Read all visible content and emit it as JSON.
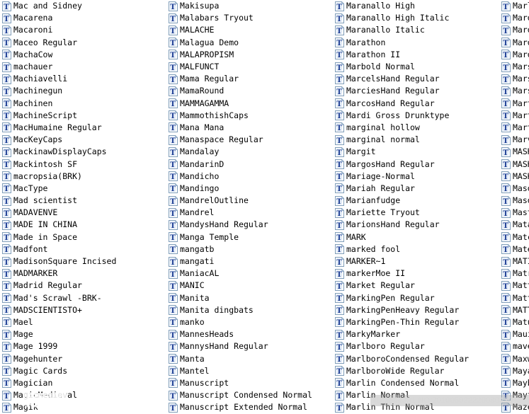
{
  "window": {
    "view": "list",
    "icon_name": "truetype-font-file-icon",
    "columns": 4,
    "rows_per_column": 34
  },
  "watermark": {
    "logo_cn": "昵图网",
    "logo_url": "www.nipic.cn",
    "id_text": "ID:3844391 NO:20100502222008043033"
  },
  "colors": {
    "background": "#ffffff",
    "text": "#000000",
    "icon_fill": "#ffffff",
    "icon_border": "#7f9db9",
    "icon_glyph": "#1f3f94",
    "icon_shade": "#c8d8ee"
  },
  "files": [
    "Mac and Sidney",
    "Macarena",
    "Macaroni",
    "Maceo Regular",
    "MachaCow",
    "machauer",
    "Machiavelli",
    "Machinegun",
    "Machinen",
    "MachineScript",
    "MacHumaine Regular",
    "MacKeyCaps",
    "MackinawDisplayCaps",
    "Mackintosh SF",
    "macropsia(BRK)",
    "MacType",
    "Mad scientist",
    "MADAVENVE",
    "MADE IN CHINA",
    "Made in Space",
    "Madfont",
    "MadisonSquare Incised",
    "MADMARKER",
    "Madrid Regular",
    "Mad's Scrawl -BRK-",
    "MADSCIENTISTO+",
    "Mael",
    "Mage",
    "Mage 1999",
    "Magehunter",
    "Magic Cards",
    "Magician",
    "MagicMedieval",
    "Magik",
    "Makisupa",
    "Malabars Tryout",
    "MALACHE",
    "Malagua Demo",
    "MALAPROPISM",
    "MALFUNCT",
    "Mama Regular",
    "MamaRound",
    "MAMMAGAMMA",
    "MammothishCaps",
    "Mana Mana",
    "Manaspace Regular",
    "Mandalay",
    "MandarinD",
    "Mandicho",
    "Mandingo",
    "MandrelOutline",
    "Mandrel",
    "MandysHand Regular",
    "Manga Temple",
    "mangatb",
    "mangati",
    "ManiacAL",
    "MANIC",
    "Manita",
    "Manita dingbats",
    "manko",
    "MannesHeads",
    "MannysHand Regular",
    "Manta",
    "Mantel",
    "Manuscript",
    "Manuscript Condensed Normal",
    "Manuscript Extended Normal",
    "Maranallo High",
    "Maranallo High Italic",
    "Maranallo Italic",
    "Marathon",
    "Marathon II",
    "Marbold Normal",
    "MarcelsHand Regular",
    "MarciesHand Regular",
    "MarcosHand Regular",
    "Mardi Gross Drunktype",
    "marginal hollow",
    "marginal normal",
    "Margit",
    "MargosHand Regular",
    "Mariage-Normal",
    "Mariah Regular",
    "Marianfudge",
    "Mariette Tryout",
    "MarionsHand Regular",
    "MARK",
    "marked fool",
    "MARKER~1",
    "markerMoe II",
    "Market Regular",
    "MarkingPen Regular",
    "MarkingPenHeavy Regular",
    "MarkingPen-Thin Regular",
    "MarkyMarker",
    "Marlboro Regular",
    "MarlboroCondensed Regular",
    "MarlboroWide Regular",
    "Marlin Condensed Normal",
    "Marlin Normal",
    "Marlin Thin Normal",
    "Marly-BoldBB Normal",
    "Marq",
    "Marquee",
    "Marquis",
    "Marquisette",
    "Marschel Normal",
    "Marsh Normal",
    "Marshmallow",
    "Martel",
    "Martin Normal",
    "Martini Regular",
    "Marvel",
    "MASH",
    "MASHED",
    "MASK",
    "Mason",
    "Masquerade",
    "Master",
    "Mata",
    "Matchbook",
    "Mateo",
    "MATISSE",
    "Matrix",
    "Matterhorn",
    "Matthew",
    "MATTY",
    "Maturasc",
    "Maui",
    "maverick",
    "Maxwell",
    "Mayan",
    "Maybe",
    "Mayfair",
    "Maze"
  ]
}
